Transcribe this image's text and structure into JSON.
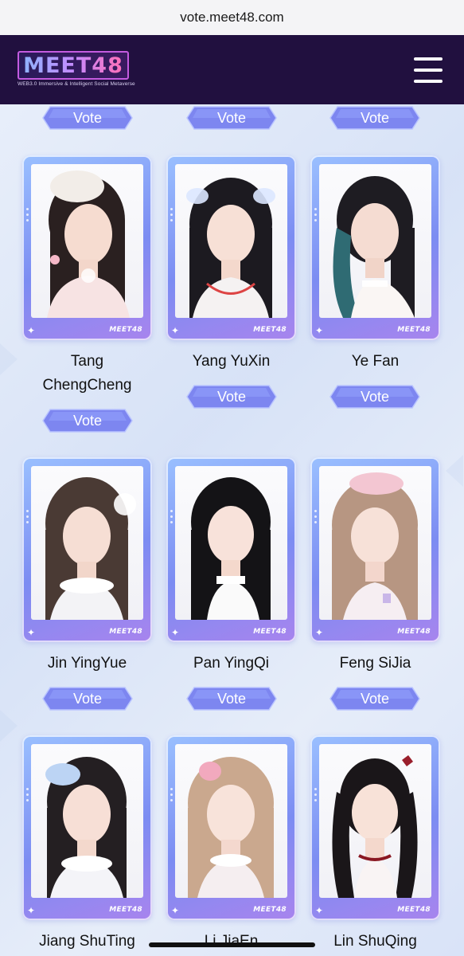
{
  "browser": {
    "url": "vote.meet48.com"
  },
  "header": {
    "logo": "MEET48",
    "tagline": "WEB3.0 Immersive & Intelligent Social Metaverse",
    "menu_icon": "hamburger-menu-icon"
  },
  "vote_label": "Vote",
  "card_brand": "MEET48",
  "colors": {
    "header_bg": "#21103f",
    "vote_button": "#7d86f0",
    "card_frame": "#8aa6f6",
    "page_bg": "#dbe5f7"
  },
  "contestants": [
    {
      "name": "Tang ChengCheng"
    },
    {
      "name": "Yang YuXin"
    },
    {
      "name": "Ye Fan"
    },
    {
      "name": "Jin YingYue"
    },
    {
      "name": "Pan YingQi"
    },
    {
      "name": "Feng SiJia"
    },
    {
      "name": "Jiang ShuTing"
    },
    {
      "name": "Li JiaEn"
    },
    {
      "name": "Lin ShuQing"
    }
  ],
  "tang_line1": "Tang",
  "tang_line2": "ChengCheng"
}
